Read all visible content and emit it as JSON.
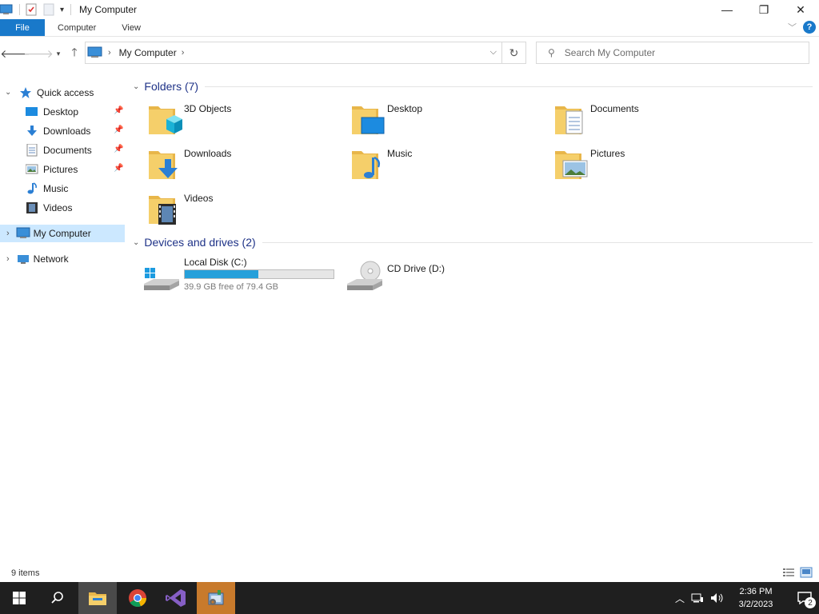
{
  "window": {
    "title": "My Computer",
    "controls": {
      "minimize": "—",
      "maximize": "❐",
      "close": "✕"
    }
  },
  "ribbon": {
    "tabs": [
      "File",
      "Computer",
      "View"
    ],
    "help": "?"
  },
  "address": {
    "location": "My Computer",
    "search_placeholder": "Search My Computer"
  },
  "nav_pane": {
    "quick_access": "Quick access",
    "quick_items": [
      {
        "label": "Desktop",
        "icon": "desktop-icon",
        "pinned": true
      },
      {
        "label": "Downloads",
        "icon": "downloads-icon",
        "pinned": true
      },
      {
        "label": "Documents",
        "icon": "documents-icon",
        "pinned": true
      },
      {
        "label": "Pictures",
        "icon": "pictures-icon",
        "pinned": true
      },
      {
        "label": "Music",
        "icon": "music-icon",
        "pinned": false
      },
      {
        "label": "Videos",
        "icon": "videos-icon",
        "pinned": false
      }
    ],
    "this_pc": "My Computer",
    "network": "Network"
  },
  "content": {
    "folders_header": "Folders (7)",
    "folders": [
      {
        "name": "3D Objects",
        "overlay": "3d-objects"
      },
      {
        "name": "Desktop",
        "overlay": "desktop"
      },
      {
        "name": "Documents",
        "overlay": "documents"
      },
      {
        "name": "Downloads",
        "overlay": "downloads"
      },
      {
        "name": "Music",
        "overlay": "music"
      },
      {
        "name": "Pictures",
        "overlay": "pictures"
      },
      {
        "name": "Videos",
        "overlay": "videos"
      }
    ],
    "drives_header": "Devices and drives (2)",
    "drives": [
      {
        "name": "Local Disk (C:)",
        "free": "39.9 GB free of 79.4 GB",
        "used_fraction": 0.497
      },
      {
        "name": "CD Drive (D:)"
      }
    ]
  },
  "status": {
    "count": "9 items"
  },
  "taskbar": {
    "time": "2:36 PM",
    "date": "3/2/2023",
    "notifications": "2"
  },
  "colors": {
    "accent": "#1979ca",
    "selection": "#cce8ff",
    "group_header": "#1e3287",
    "capacity_fill": "#26a0da",
    "taskbar": "#1f1f1f"
  }
}
